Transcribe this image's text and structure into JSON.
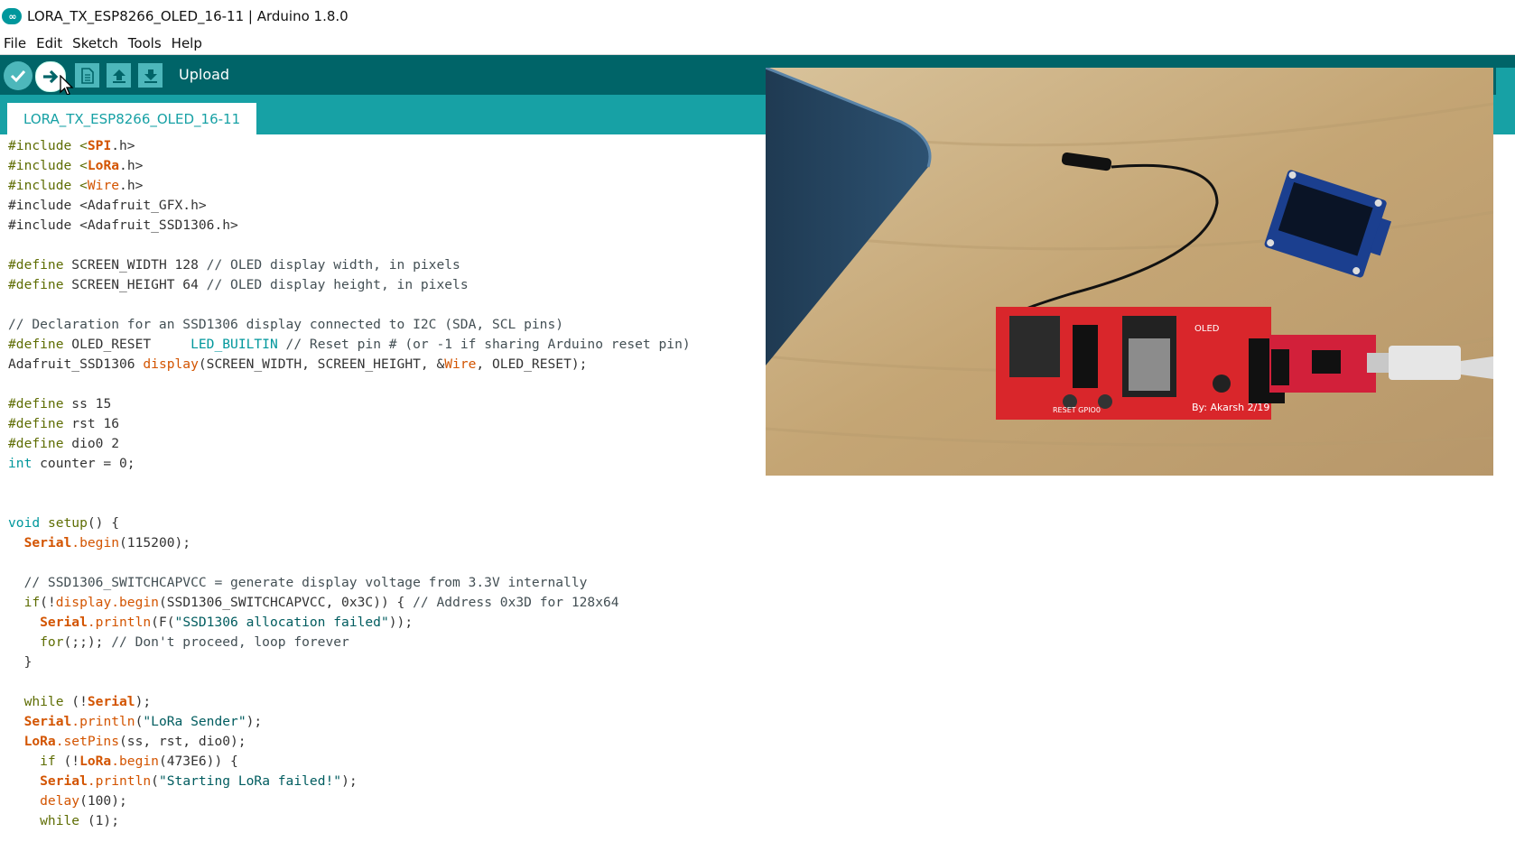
{
  "window": {
    "title": "LORA_TX_ESP8266_OLED_16-11 | Arduino 1.8.0",
    "app_icon_glyph": "∞"
  },
  "menu": [
    "File",
    "Edit",
    "Sketch",
    "Tools",
    "Help"
  ],
  "toolbar": {
    "hover_label": "Upload"
  },
  "tab": {
    "label": "LORA_TX_ESP8266_OLED_16-11"
  },
  "code": {
    "l1_pre": "#include <",
    "l1_lib": "SPI",
    "l1_post": ".h>",
    "l2_pre": "#include <",
    "l2_lib": "LoRa",
    "l2_post": ".h>",
    "l3_pre": "#include <",
    "l3_lib": "Wire",
    "l3_post": ".h>",
    "l4": "#include <Adafruit_GFX.h>",
    "l5": "#include <Adafruit_SSD1306.h>",
    "l6_kw": "#define",
    "l6_rest": " SCREEN_WIDTH 128 ",
    "l6_cm": "// OLED display width, in pixels",
    "l7_kw": "#define",
    "l7_rest": " SCREEN_HEIGHT 64 ",
    "l7_cm": "// OLED display height, in pixels",
    "l8_cm": "// Declaration for an SSD1306 display connected to I2C (SDA, SCL pins)",
    "l9_kw": "#define",
    "l9_rest": " OLED_RESET     ",
    "l9_ty": "LED_BUILTIN",
    "l9_cm": " // Reset pin # (or -1 if sharing Arduino reset pin)",
    "l10_a": "Adafruit_SSD1306 ",
    "l10_fn": "display",
    "l10_b": "(SCREEN_WIDTH, SCREEN_HEIGHT, &",
    "l10_lib": "Wire",
    "l10_c": ", OLED_RESET);",
    "l11_kw": "#define",
    "l11_rest": " ss 15",
    "l12_kw": "#define",
    "l12_rest": " rst 16",
    "l13_kw": "#define",
    "l13_rest": " dio0 2",
    "l14_kw": "int",
    "l14_rest": " counter = 0;",
    "l15_kw": "void",
    "l15_fn": " setup",
    "l15_rest": "() {",
    "l16_obj": "  Serial",
    "l16_fn": ".begin",
    "l16_rest": "(115200);",
    "l17_cm": "  // SSD1306_SWITCHCAPVCC = generate display voltage from 3.3V internally",
    "l18_kw": "  if",
    "l18_a": "(!",
    "l18_fn": "display.begin",
    "l18_b": "(SSD1306_SWITCHCAPVCC, 0x3C)) { ",
    "l18_cm": "// Address 0x3D for 128x64",
    "l19_obj": "    Serial",
    "l19_fn": ".println",
    "l19_a": "(F(",
    "l19_st": "\"SSD1306 allocation failed\"",
    "l19_b": "));",
    "l20_kw": "    for",
    "l20_rest": "(;;); ",
    "l20_cm": "// Don't proceed, loop forever",
    "l21": "  }",
    "l22_kw": "  while",
    "l22_a": " (!",
    "l22_obj": "Serial",
    "l22_b": ");",
    "l23_obj": "  Serial",
    "l23_fn": ".println",
    "l23_a": "(",
    "l23_st": "\"LoRa Sender\"",
    "l23_b": ");",
    "l24_obj": "  LoRa",
    "l24_fn": ".setPins",
    "l24_rest": "(ss, rst, dio0);",
    "l25_kw": "    if",
    "l25_a": " (!",
    "l25_obj": "LoRa",
    "l25_fn": ".begin",
    "l25_b": "(473E6)) {",
    "l26_obj": "    Serial",
    "l26_fn": ".println",
    "l26_a": "(",
    "l26_st": "\"Starting LoRa failed!\"",
    "l26_b": ");",
    "l27_fn": "    delay",
    "l27_rest": "(100);",
    "l28_kw": "    while",
    "l28_rest": " (1);"
  },
  "photo": {
    "board_caption": "By: Akarsh 2/19",
    "oled_label": "OLED",
    "btn_labels": "RESET  GPIO0"
  },
  "colors": {
    "toolbar": "#006468",
    "tabbar": "#17a1a5",
    "keyword": "#5e6d03",
    "type": "#00979c",
    "function": "#d35400"
  }
}
